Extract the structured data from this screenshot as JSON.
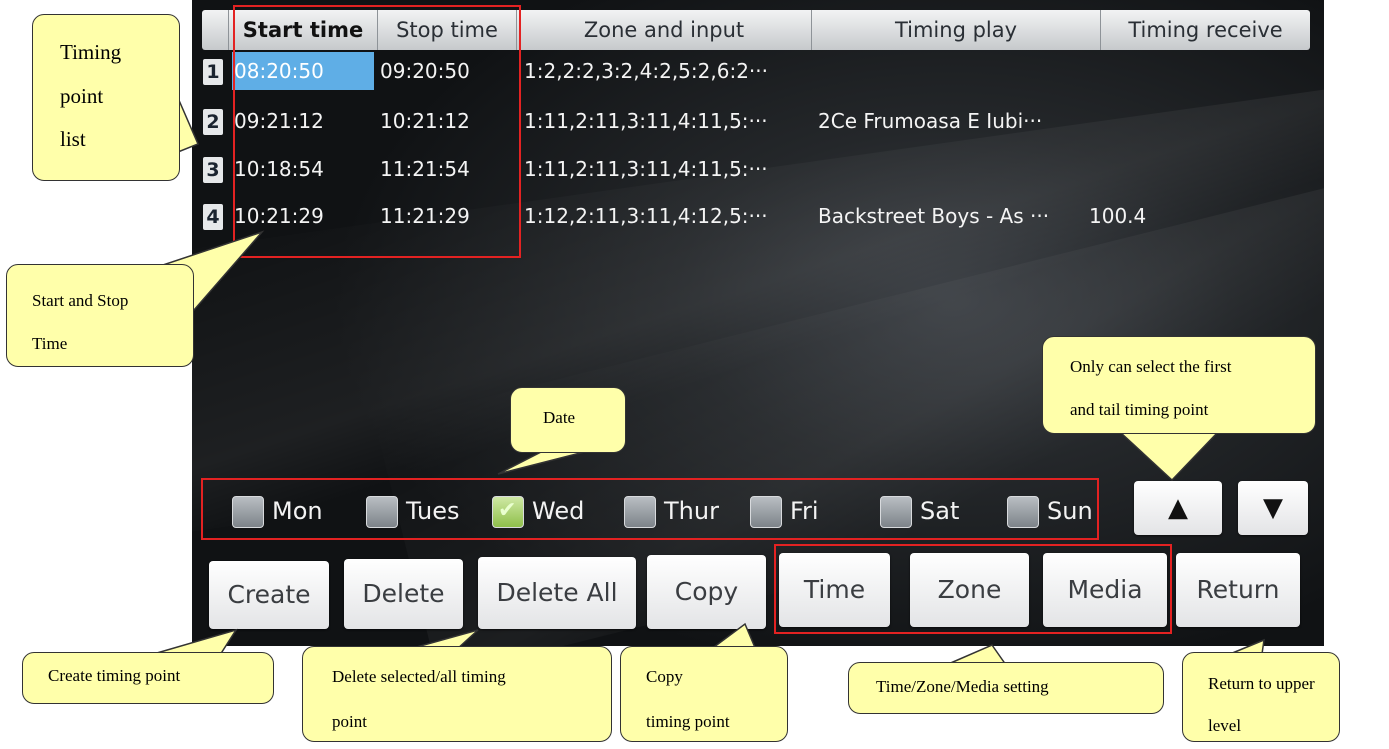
{
  "table": {
    "headers": [
      "Start time",
      "Stop time",
      "Zone and input",
      "Timing play",
      "Timing receive"
    ],
    "rows": [
      {
        "num": "1",
        "start": "08:20:50",
        "stop": "09:20:50",
        "zone": "1:2,2:2,3:2,4:2,5:2,6:2···",
        "play": "",
        "receive": ""
      },
      {
        "num": "2",
        "start": "09:21:12",
        "stop": "10:21:12",
        "zone": "1:11,2:11,3:11,4:11,5:···",
        "play": "2Ce Frumoasa E Iubi···",
        "receive": ""
      },
      {
        "num": "3",
        "start": "10:18:54",
        "stop": "11:21:54",
        "zone": "1:11,2:11,3:11,4:11,5:···",
        "play": "",
        "receive": ""
      },
      {
        "num": "4",
        "start": "10:21:29",
        "stop": "11:21:29",
        "zone": "1:12,2:11,3:11,4:12,5:···",
        "play": "Backstreet Boys - As ···",
        "receive": "100.4"
      }
    ]
  },
  "days": [
    {
      "label": "Mon",
      "checked": false
    },
    {
      "label": "Tues",
      "checked": false
    },
    {
      "label": "Wed",
      "checked": true
    },
    {
      "label": "Thur",
      "checked": false
    },
    {
      "label": "Fri",
      "checked": false
    },
    {
      "label": "Sat",
      "checked": false
    },
    {
      "label": "Sun",
      "checked": false
    }
  ],
  "nav": {
    "up_icon": "▲",
    "down_icon": "▼"
  },
  "buttons": {
    "create": "Create",
    "delete": "Delete",
    "delete_all": "Delete All",
    "copy": "Copy",
    "time": "Time",
    "zone": "Zone",
    "media": "Media",
    "return": "Return"
  },
  "annotations": {
    "list": [
      "Timing",
      "point",
      "list"
    ],
    "start_stop": [
      "Start and Stop",
      "Time"
    ],
    "date": "Date",
    "select": [
      "Only can select the first",
      "and tail timing point"
    ],
    "create": "Create timing point",
    "delete": [
      "Delete selected/all timing",
      "point"
    ],
    "copy": [
      "Copy",
      "timing point"
    ],
    "settings": "Time/Zone/Media setting",
    "return": [
      "Return to upper",
      "level"
    ]
  }
}
